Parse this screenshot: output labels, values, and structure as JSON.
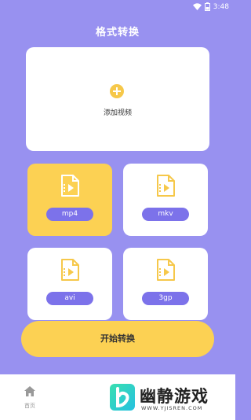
{
  "status_bar": {
    "time": "3:48"
  },
  "header": {
    "title": "格式转换"
  },
  "add_video": {
    "label": "添加视频"
  },
  "formats": [
    {
      "label": "mp4",
      "selected": true
    },
    {
      "label": "mkv",
      "selected": false
    },
    {
      "label": "avi",
      "selected": false
    },
    {
      "label": "3gp",
      "selected": false
    }
  ],
  "start_button": {
    "label": "开始转换"
  },
  "bottom_nav": {
    "home_label": "首页"
  },
  "watermark": {
    "text": "幽静游戏",
    "url": "WWW.YJISREN.COM"
  },
  "colors": {
    "background": "#9891f0",
    "accent": "#fcd153",
    "pill": "#7c72ea"
  }
}
